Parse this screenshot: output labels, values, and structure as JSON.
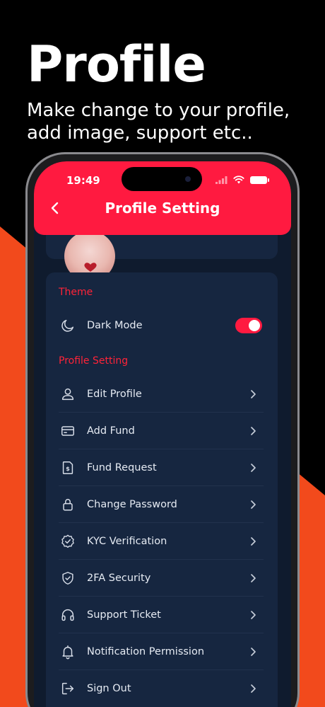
{
  "promo": {
    "title": "Profile",
    "subtitle_line1": "Make change to your profile,",
    "subtitle_line2": "add image, support etc.."
  },
  "colors": {
    "accent": "#ff1a40",
    "background": "#0f1b2e",
    "card": "#162640",
    "section_label": "#ff2338",
    "promo_orange": "#f24a1c"
  },
  "status_bar": {
    "time": "19:49"
  },
  "header": {
    "title": "Profile Setting",
    "back_icon": "chevron-left-icon"
  },
  "theme_section": {
    "label": "Theme",
    "dark_mode": {
      "label": "Dark Mode",
      "icon": "moon-icon",
      "enabled": true
    }
  },
  "profile_section": {
    "label": "Profile Setting",
    "items": [
      {
        "label": "Edit Profile",
        "icon": "user-icon"
      },
      {
        "label": "Add Fund",
        "icon": "credit-card-icon"
      },
      {
        "label": "Fund Request",
        "icon": "dollar-document-icon"
      },
      {
        "label": "Change Password",
        "icon": "lock-icon"
      },
      {
        "label": "KYC Verification",
        "icon": "verified-badge-icon"
      },
      {
        "label": "2FA Security",
        "icon": "shield-check-icon"
      },
      {
        "label": "Support Ticket",
        "icon": "headphones-icon"
      },
      {
        "label": "Notification Permission",
        "icon": "bell-icon"
      },
      {
        "label": "Sign Out",
        "icon": "sign-out-icon"
      }
    ]
  }
}
